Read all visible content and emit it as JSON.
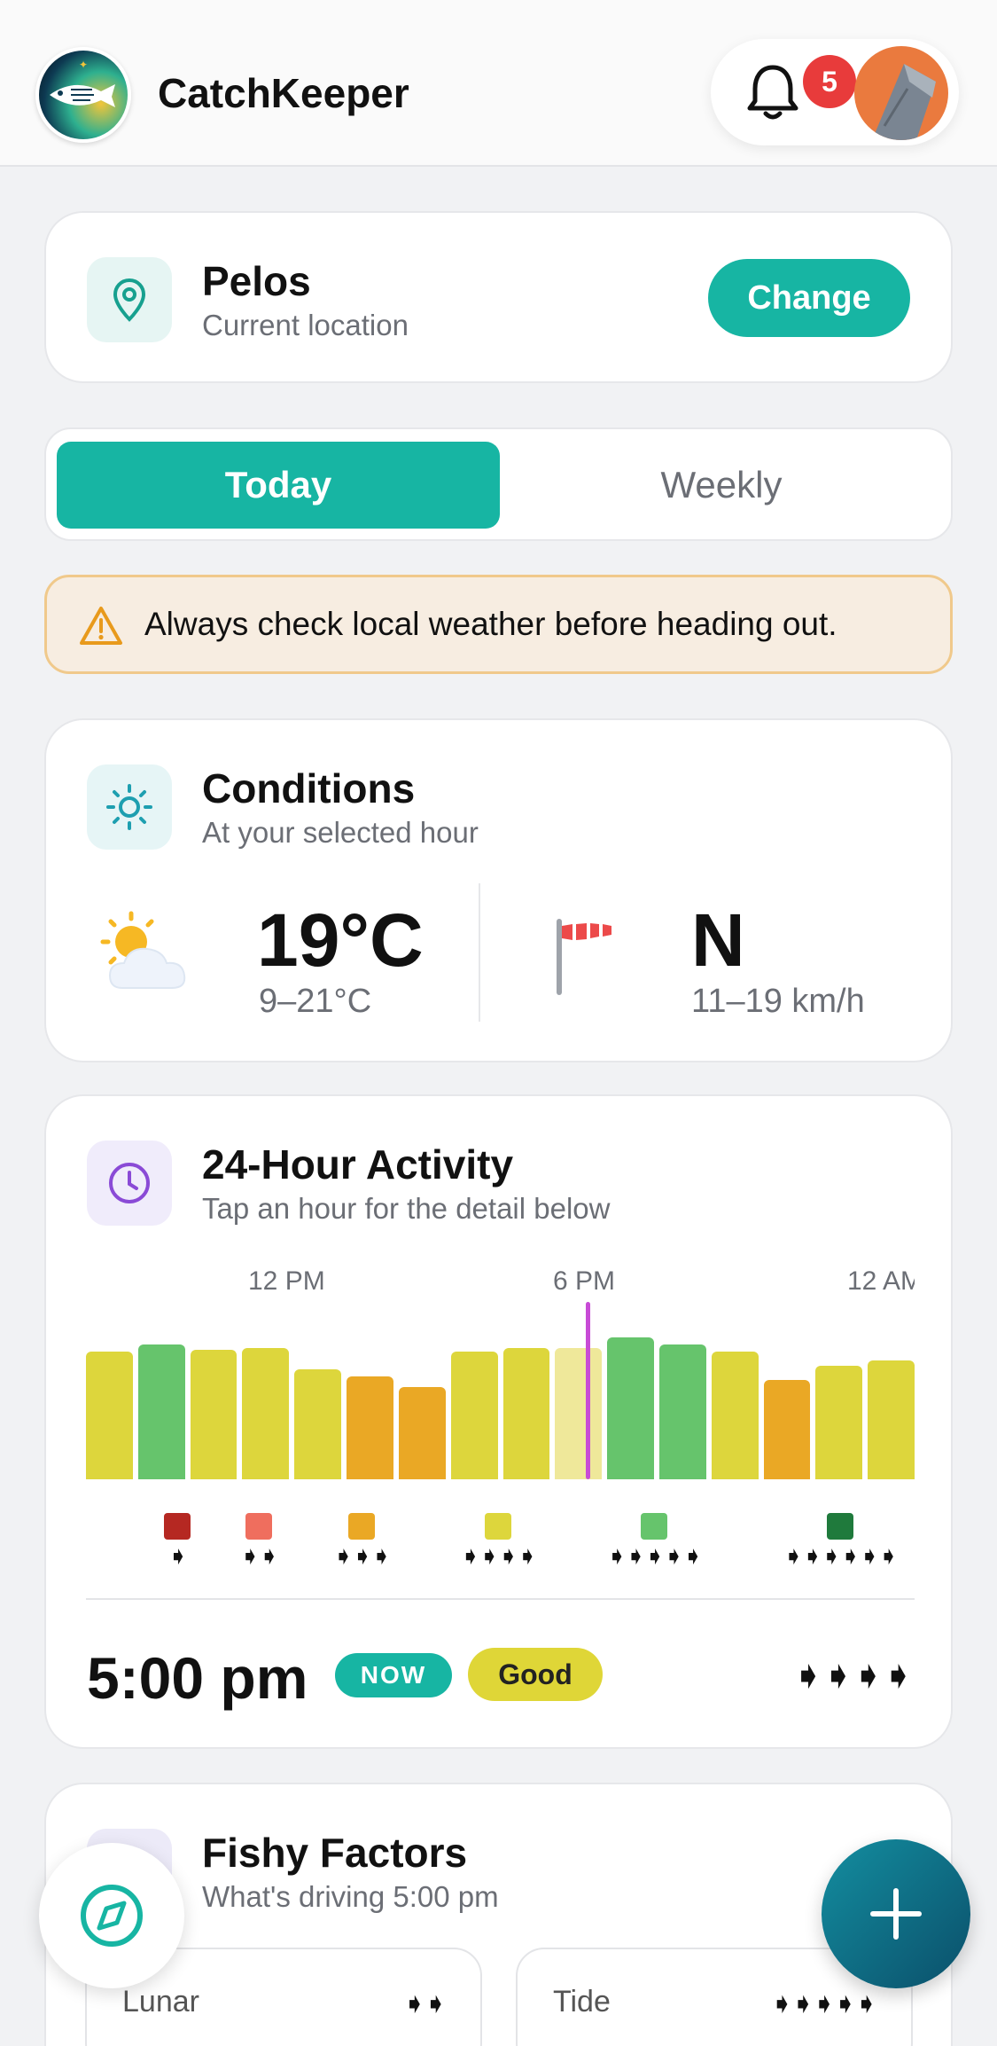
{
  "header": {
    "app_title": "CatchKeeper",
    "notification_count": "5",
    "logo_icon": "fish-logo-icon",
    "avatar_icon": "fish-avatar"
  },
  "location": {
    "name": "Pelos",
    "subtitle": "Current location",
    "change_label": "Change"
  },
  "tabs": [
    {
      "label": "Today",
      "active": true
    },
    {
      "label": "Weekly",
      "active": false
    }
  ],
  "warning": {
    "text": "Always check local weather before heading out."
  },
  "conditions": {
    "title": "Conditions",
    "subtitle": "At your selected hour",
    "temperature": "19°C",
    "temp_range": "9–21°C",
    "wind_direction": "N",
    "wind_range": "11–19 km/h"
  },
  "activity": {
    "title": "24-Hour Activity",
    "subtitle": "Tap an hour for the detail below",
    "ticks": [
      "12 PM",
      "6 PM",
      "12 AM"
    ],
    "bars": [
      {
        "level": 0.72,
        "color": "#ddd63c"
      },
      {
        "level": 0.76,
        "color": "#66c46c"
      },
      {
        "level": 0.73,
        "color": "#ddd63c"
      },
      {
        "level": 0.74,
        "color": "#ddd63c"
      },
      {
        "level": 0.62,
        "color": "#ddd63c"
      },
      {
        "level": 0.58,
        "color": "#eaa825"
      },
      {
        "level": 0.52,
        "color": "#eaa825"
      },
      {
        "level": 0.72,
        "color": "#ddd63c"
      },
      {
        "level": 0.74,
        "color": "#ddd63c"
      },
      {
        "level": 0.74,
        "color": "#efe89a"
      },
      {
        "level": 0.8,
        "color": "#66c46c"
      },
      {
        "level": 0.76,
        "color": "#66c46c"
      },
      {
        "level": 0.72,
        "color": "#ddd63c"
      },
      {
        "level": 0.56,
        "color": "#eaa825"
      },
      {
        "level": 0.64,
        "color": "#ddd63c"
      },
      {
        "level": 0.67,
        "color": "#ddd63c"
      }
    ],
    "legend": [
      {
        "color": "#b52822",
        "fish": "➧"
      },
      {
        "color": "#ef6e5e",
        "fish": "➧➧"
      },
      {
        "color": "#eaa825",
        "fish": "➧➧➧"
      },
      {
        "color": "#ddd63c",
        "fish": "➧➧➧➧"
      },
      {
        "color": "#66c46c",
        "fish": "➧➧➧➧➧"
      },
      {
        "color": "#1f7a3c",
        "fish": "➧➧➧➧➧➧"
      }
    ],
    "selected_time": "5:00 pm",
    "now_label": "NOW",
    "rating": "Good",
    "rating_fish": "➧➧➧➧"
  },
  "factors": {
    "title": "Fishy Factors",
    "subtitle": "What's driving 5:00 pm",
    "items": [
      {
        "label": "Lunar",
        "fish": "➧➧"
      },
      {
        "label": "Tide",
        "fish": "➧➧➧➧➧"
      }
    ]
  },
  "colors": {
    "accent": "#17b5a3",
    "badge": "#e83b3b",
    "now_marker": "#c84bd6"
  }
}
